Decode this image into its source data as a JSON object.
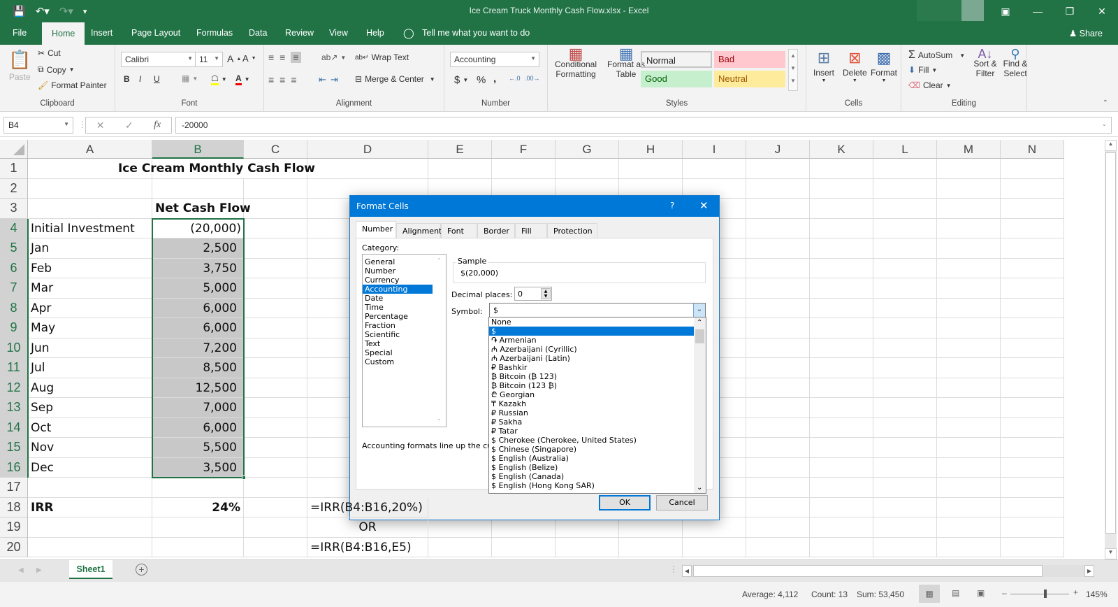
{
  "window": {
    "title": "Ice Cream Truck Monthly Cash Flow.xlsx  -  Excel",
    "qat": {
      "save_icon": "save-icon",
      "undo_icon": "undo-icon",
      "redo_icon": "redo-icon",
      "customize_icon": "customize-qat-icon"
    },
    "controls": [
      "ribbon-display-options",
      "minimize",
      "restore",
      "close"
    ]
  },
  "tabs": {
    "items": [
      "File",
      "Home",
      "Insert",
      "Page Layout",
      "Formulas",
      "Data",
      "Review",
      "View",
      "Help"
    ],
    "active": "Home",
    "tell_me": "Tell me what you want to do",
    "share": "Share"
  },
  "ribbon": {
    "clipboard": {
      "label": "Clipboard",
      "paste": "Paste",
      "cut": "Cut",
      "copy": "Copy",
      "format_painter": "Format Painter"
    },
    "font": {
      "label": "Font",
      "font_name": "Calibri",
      "font_size": "11",
      "bold": "B",
      "italic": "I",
      "underline": "U"
    },
    "alignment": {
      "label": "Alignment",
      "wrap_text": "Wrap Text",
      "merge_center": "Merge & Center"
    },
    "number": {
      "label": "Number",
      "format": "Accounting",
      "currency": "$",
      "percent": "%",
      "comma": ","
    },
    "styles": {
      "label": "Styles",
      "conditional_formatting": "Conditional Formatting",
      "format_as_table": "Format as Table",
      "cells": [
        {
          "name": "Normal",
          "bg": "#ffffff",
          "fg": "#000000"
        },
        {
          "name": "Bad",
          "bg": "#ffc7ce",
          "fg": "#9c0006"
        },
        {
          "name": "Good",
          "bg": "#c6efce",
          "fg": "#006100"
        },
        {
          "name": "Neutral",
          "bg": "#ffeb9c",
          "fg": "#9c5700"
        }
      ]
    },
    "cells": {
      "label": "Cells",
      "insert": "Insert",
      "delete": "Delete",
      "format": "Format"
    },
    "editing": {
      "label": "Editing",
      "autosum": "AutoSum",
      "fill": "Fill",
      "clear": "Clear",
      "sort_filter": "Sort & Filter",
      "find_select": "Find & Select"
    }
  },
  "formula_bar": {
    "name_box": "B4",
    "formula": "-20000",
    "fx": "fx"
  },
  "columns": [
    "A",
    "B",
    "C",
    "D",
    "E",
    "F",
    "G",
    "H",
    "I",
    "J",
    "K",
    "L",
    "M",
    "N"
  ],
  "selected_column": "B",
  "rows": [
    {
      "n": "1",
      "A": "",
      "B": "Ice Cream Monthly Cash Flow",
      "D": ""
    },
    {
      "n": "2",
      "A": "",
      "B": "",
      "D": ""
    },
    {
      "n": "3",
      "A": "",
      "B": "Net Cash Flow",
      "D": ""
    },
    {
      "n": "4",
      "A": "Initial Investment",
      "B": "(20,000)",
      "D": ""
    },
    {
      "n": "5",
      "A": "Jan",
      "B": "2,500",
      "D": ""
    },
    {
      "n": "6",
      "A": "Feb",
      "B": "3,750",
      "D": ""
    },
    {
      "n": "7",
      "A": "Mar",
      "B": "5,000",
      "D": ""
    },
    {
      "n": "8",
      "A": "Apr",
      "B": "6,000",
      "D": ""
    },
    {
      "n": "9",
      "A": "May",
      "B": "6,000",
      "D": ""
    },
    {
      "n": "10",
      "A": "Jun",
      "B": "7,200",
      "D": ""
    },
    {
      "n": "11",
      "A": "Jul",
      "B": "8,500",
      "D": ""
    },
    {
      "n": "12",
      "A": "Aug",
      "B": "12,500",
      "D": ""
    },
    {
      "n": "13",
      "A": "Sep",
      "B": "7,000",
      "D": ""
    },
    {
      "n": "14",
      "A": "Oct",
      "B": "6,000",
      "D": ""
    },
    {
      "n": "15",
      "A": "Nov",
      "B": "5,500",
      "D": ""
    },
    {
      "n": "16",
      "A": "Dec",
      "B": "3,500",
      "D": ""
    },
    {
      "n": "17",
      "A": "",
      "B": "",
      "D": ""
    },
    {
      "n": "18",
      "A": "IRR",
      "B": "24%",
      "D": "=IRR(B4:B16,20%)"
    },
    {
      "n": "19",
      "A": "",
      "B": "",
      "D": "OR"
    },
    {
      "n": "20",
      "A": "",
      "B": "",
      "D": "=IRR(B4:B16,E5)"
    }
  ],
  "sheets": {
    "items": [
      "Sheet1"
    ],
    "active": "Sheet1"
  },
  "status": {
    "average": "Average: 4,112",
    "count": "Count: 13",
    "sum": "Sum: 53,450",
    "zoom": "145%",
    "zoom_fraction": 0.6
  },
  "dialog": {
    "title": "Format Cells",
    "help": "?",
    "tabs": [
      "Number",
      "Alignment",
      "Font",
      "Border",
      "Fill",
      "Protection"
    ],
    "active_tab": "Number",
    "category_label": "Category:",
    "categories": [
      "General",
      "Number",
      "Currency",
      "Accounting",
      "Date",
      "Time",
      "Percentage",
      "Fraction",
      "Scientific",
      "Text",
      "Special",
      "Custom"
    ],
    "selected_category": "Accounting",
    "sample_label": "Sample",
    "sample_value": "$(20,000)",
    "decimal_label": "Decimal places:",
    "decimal_value": "0",
    "symbol_label": "Symbol:",
    "symbol_value": "$",
    "symbol_options": [
      "None",
      "$",
      "֏ Armenian",
      "₼ Azerbaijani (Cyrillic)",
      "₼ Azerbaijani (Latin)",
      "₽ Bashkir",
      "₿ Bitcoin (₿ 123)",
      "₿ Bitcoin (123 ₿)",
      "₾ Georgian",
      "₸ Kazakh",
      "₽ Russian",
      "₽ Sakha",
      "₽ Tatar",
      "$ Cherokee (Cherokee, United States)",
      "$ Chinese (Singapore)",
      "$ English (Australia)",
      "$ English (Belize)",
      "$ English (Canada)",
      "$ English (Hong Kong SAR)"
    ],
    "selected_symbol": "$",
    "description": "Accounting formats line up the cur",
    "ok": "OK",
    "cancel": "Cancel"
  }
}
